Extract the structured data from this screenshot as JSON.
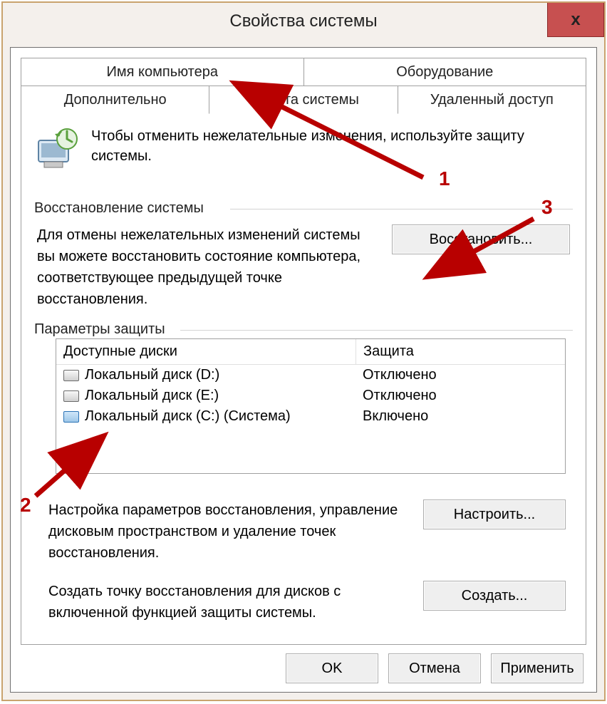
{
  "window": {
    "title": "Свойства системы",
    "close_label": "x"
  },
  "tabs_row1": [
    {
      "label": "Имя компьютера"
    },
    {
      "label": "Оборудование"
    }
  ],
  "tabs_row2": [
    {
      "label": "Дополнительно"
    },
    {
      "label": "Защита системы",
      "active": true
    },
    {
      "label": "Удаленный доступ"
    }
  ],
  "intro_text": "Чтобы отменить нежелательные изменения, используйте защиту системы.",
  "restore": {
    "legend": "Восстановление системы",
    "desc": "Для отмены нежелательных изменений системы вы можете восстановить состояние компьютера, соответствующее предыдущей точке восстановления.",
    "button": "Восстановить..."
  },
  "protection": {
    "legend": "Параметры защиты",
    "columns": {
      "a": "Доступные диски",
      "b": "Защита"
    },
    "disks": [
      {
        "name": "Локальный диск (D:)",
        "status": "Отключено",
        "sys": false
      },
      {
        "name": "Локальный диск (E:)",
        "status": "Отключено",
        "sys": false
      },
      {
        "name": "Локальный диск (C:) (Система)",
        "status": "Включено",
        "sys": true
      }
    ],
    "configure_desc": "Настройка параметров восстановления, управление дисковым пространством и удаление точек восстановления.",
    "configure_btn": "Настроить...",
    "create_desc": "Создать точку восстановления для дисков с включенной функцией защиты системы.",
    "create_btn": "Создать..."
  },
  "buttons": {
    "ok": "OK",
    "cancel": "Отмена",
    "apply": "Применить"
  },
  "annotations": {
    "a1": "1",
    "a2": "2",
    "a3": "3"
  }
}
